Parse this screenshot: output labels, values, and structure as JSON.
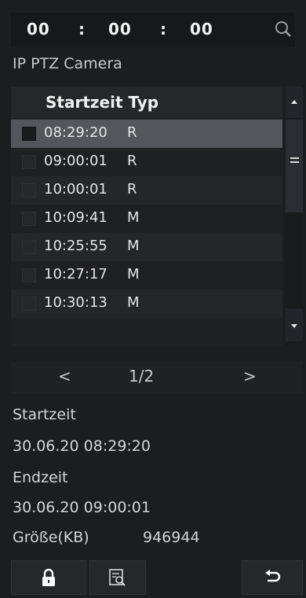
{
  "time_filter": {
    "hours": "00",
    "minutes": "00",
    "seconds": "00",
    "separator": ":"
  },
  "camera_title": "IP PTZ Camera",
  "list": {
    "header": "Startzeit Typ",
    "rows": [
      {
        "time": "08:29:20",
        "type": "R",
        "selected": true
      },
      {
        "time": "09:00:01",
        "type": "R",
        "selected": false
      },
      {
        "time": "10:00:01",
        "type": "R",
        "selected": false
      },
      {
        "time": "10:09:41",
        "type": "M",
        "selected": false
      },
      {
        "time": "10:25:55",
        "type": "M",
        "selected": false
      },
      {
        "time": "10:27:17",
        "type": "M",
        "selected": false
      },
      {
        "time": "10:30:13",
        "type": "M",
        "selected": false
      }
    ]
  },
  "pager": {
    "prev": "<",
    "page": "1/2",
    "next": ">"
  },
  "details": {
    "start_label": "Startzeit",
    "start_value": "30.06.20 08:29:20",
    "end_label": "Endzeit",
    "end_value": "30.06.20 09:00:01",
    "size_label": "Größe(KB)",
    "size_value": "946944"
  },
  "toolbar": {
    "icons": [
      "lock-icon",
      "search-file-icon",
      "back-icon"
    ]
  },
  "colors": {
    "background": "#1c1d21",
    "selected_row": "#54565b",
    "text": "#e3e4e6"
  }
}
